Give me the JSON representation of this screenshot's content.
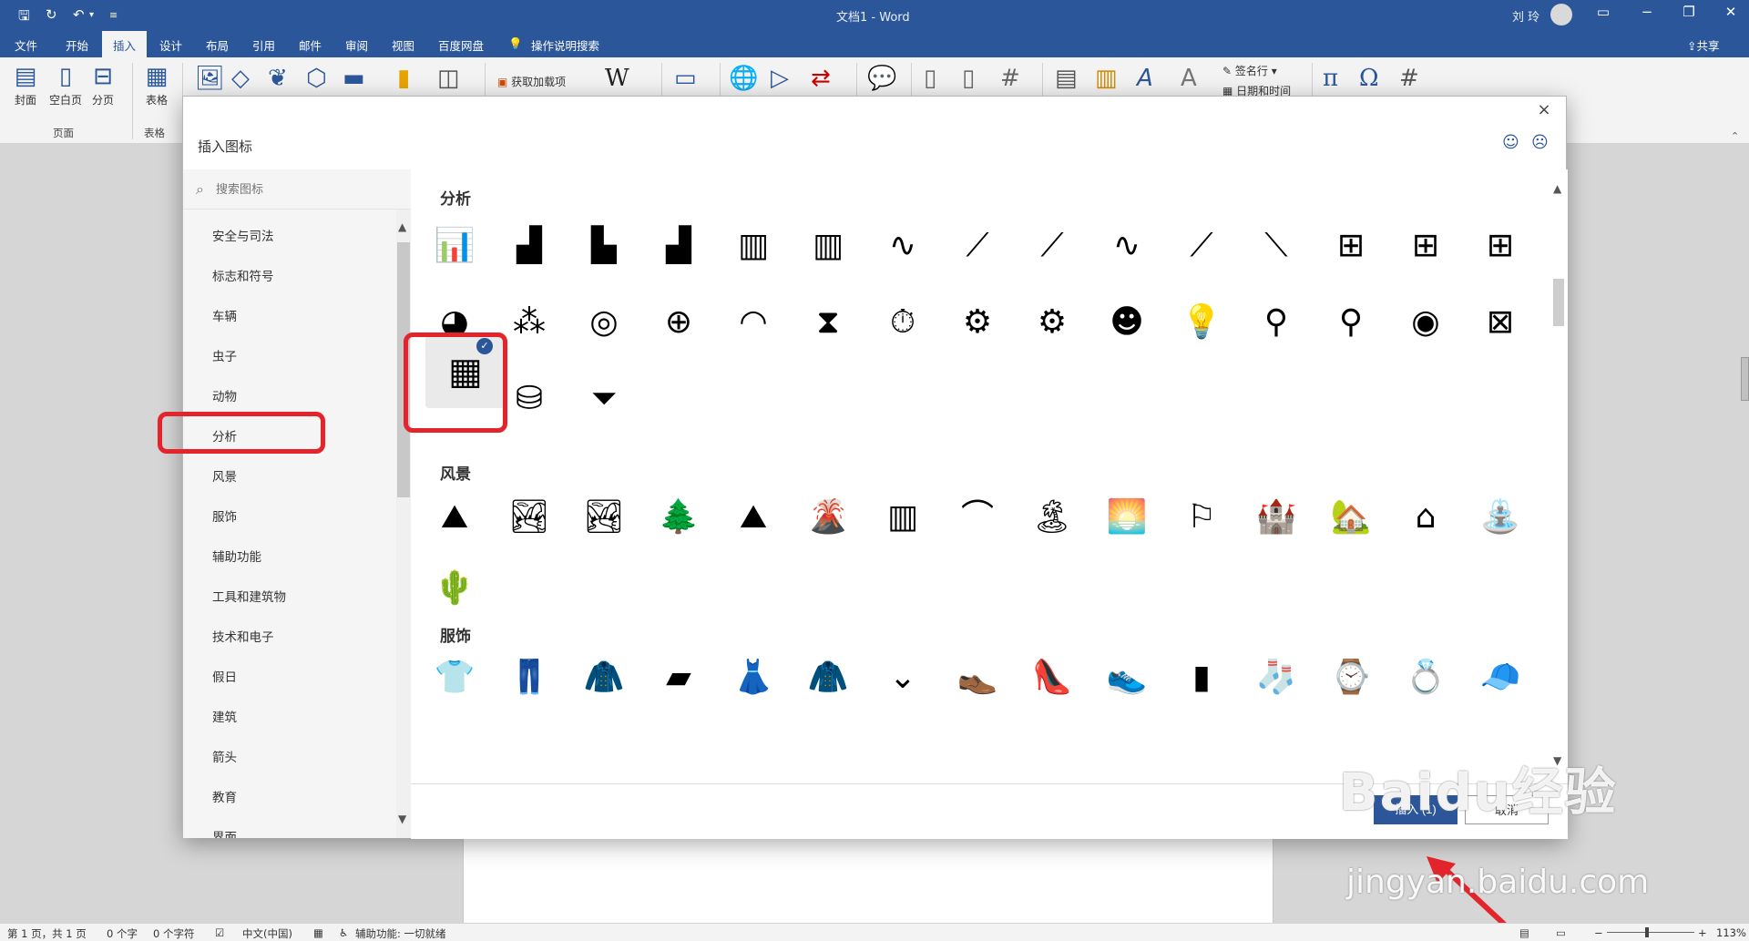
{
  "window": {
    "title": "文档1 - Word",
    "user": "刘 玲",
    "share": "共享"
  },
  "quick_access": {
    "save_icon": "save-icon",
    "autosave_icon": "refresh-icon",
    "undo_icon": "undo-icon",
    "customize_icon": "customize-icon"
  },
  "menu": {
    "items": [
      "文件",
      "开始",
      "插入",
      "设计",
      "布局",
      "引用",
      "邮件",
      "审阅",
      "视图",
      "百度网盘"
    ],
    "active": "插入",
    "tell_me": "操作说明搜索"
  },
  "ribbon": {
    "cover": "封面",
    "blank": "空白页",
    "pagebreak": "分页",
    "group_pages": "页面",
    "table": "表格",
    "group_table": "表格",
    "addins": "获取加载项",
    "wiki": "W",
    "signature": "签名行",
    "datetime": "日期和时间",
    "pi": "π",
    "omega": "Ω"
  },
  "dialog": {
    "title": "插入图标",
    "close": "×",
    "search_placeholder": "搜索图标",
    "categories": [
      "安全与司法",
      "标志和符号",
      "车辆",
      "虫子",
      "动物",
      "分析",
      "风景",
      "服饰",
      "辅助功能",
      "工具和建筑物",
      "技术和电子",
      "假日",
      "建筑",
      "箭头",
      "教育",
      "界面"
    ],
    "sections": {
      "analysis": "分析",
      "landscape": "风景",
      "clothing": "服饰"
    },
    "insert_button": "插入 (1)",
    "cancel_button": "取消"
  },
  "status": {
    "page": "第 1 页，共 1 页",
    "words": "0 个字",
    "chars": "0 个字符",
    "lang": "中文(中国)",
    "accessibility": "辅助功能: 一切就绪",
    "zoom": "113%"
  },
  "watermark": {
    "brand": "Baidu经验",
    "url": "jingyan.baidu.com"
  },
  "colors": {
    "ribbon_blue": "#2b579a",
    "highlight_red": "#e3242b"
  }
}
